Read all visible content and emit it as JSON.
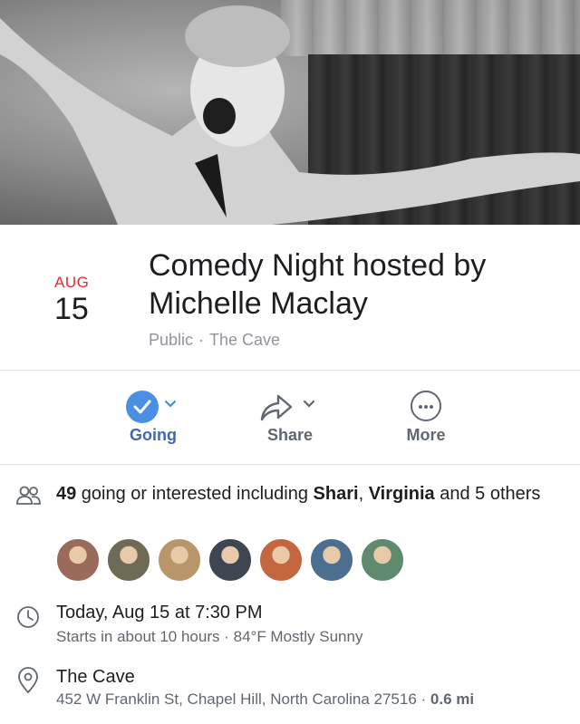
{
  "event": {
    "month": "AUG",
    "day": "15",
    "title": "Comedy Night hosted by Michelle Maclay",
    "privacy": "Public",
    "separator": "·",
    "venue_short": "The Cave"
  },
  "actions": {
    "going_label": "Going",
    "share_label": "Share",
    "more_label": "More"
  },
  "guests": {
    "count": "49",
    "text_prefix": " going or interested including ",
    "name1": "Shari",
    "comma": ", ",
    "name2": "Virginia",
    "text_suffix": " and 5 others",
    "avatars": [
      {
        "name": "guest-avatar-1",
        "color": "#9a6b5a"
      },
      {
        "name": "guest-avatar-2",
        "color": "#6f6a55"
      },
      {
        "name": "guest-avatar-3",
        "color": "#b8966a"
      },
      {
        "name": "guest-avatar-4",
        "color": "#3e4652"
      },
      {
        "name": "guest-avatar-5",
        "color": "#c4663f"
      },
      {
        "name": "guest-avatar-6",
        "color": "#4d6f8f"
      },
      {
        "name": "guest-avatar-7",
        "color": "#5f8a6e"
      }
    ]
  },
  "time": {
    "main": "Today, Aug 15 at 7:30 PM",
    "sub": "Starts in about 10 hours · 84°F Mostly Sunny"
  },
  "location": {
    "name": "The Cave",
    "address": "452 W Franklin St, Chapel Hill, North Carolina 27516",
    "separator": " · ",
    "distance": "0.6 mi"
  },
  "colors": {
    "accent": "#4267b2",
    "going_circle": "#4a90e2",
    "date_month": "#e02b2b",
    "secondary_text": "#606770"
  }
}
